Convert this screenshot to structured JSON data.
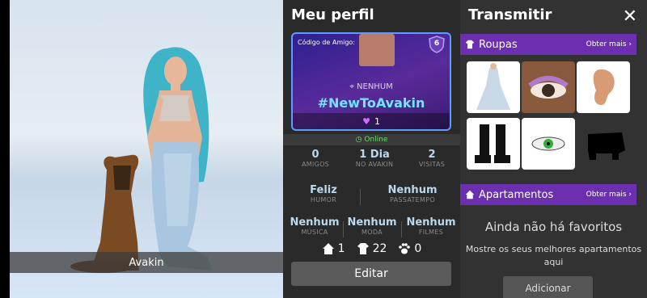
{
  "avatar": {
    "name": "Avakin"
  },
  "profile": {
    "title": "Meu perfil",
    "friend_code_label": "Código de Amigo:",
    "level": "6",
    "location": "NENHUM",
    "hashtag": "#NewToAvakin",
    "likes": "1",
    "status": "Online",
    "stats": [
      {
        "value": "0",
        "label": "AMIGOS"
      },
      {
        "value": "1 Dia",
        "label": "NO AVAKIN"
      },
      {
        "value": "2",
        "label": "VISITAS"
      }
    ],
    "mood": {
      "value": "Feliz",
      "label": "HUMOR"
    },
    "hobby": {
      "value": "Nenhum",
      "label": "PASSATEMPO"
    },
    "music": {
      "value": "Nenhum",
      "label": "MÚSICA"
    },
    "fashion": {
      "value": "Nenhum",
      "label": "MODA"
    },
    "films": {
      "value": "Nenhum",
      "label": "FILMES"
    },
    "counts": {
      "homes": "1",
      "outfits": "22",
      "pets": "0"
    },
    "edit_label": "Editar"
  },
  "right": {
    "title": "Transmitir",
    "clothes": {
      "title": "Roupas",
      "more": "Obter mais"
    },
    "apartments": {
      "title": "Apartamentos",
      "more": "Obter mais"
    },
    "empty_title": "Ainda não há favoritos",
    "empty_text": "Mostre os seus melhores apartamentos aqui",
    "add_label": "Adicionar"
  },
  "colors": {
    "accent": "#6c2fb0",
    "tag": "#6fe6ff",
    "online": "#66e06b"
  }
}
